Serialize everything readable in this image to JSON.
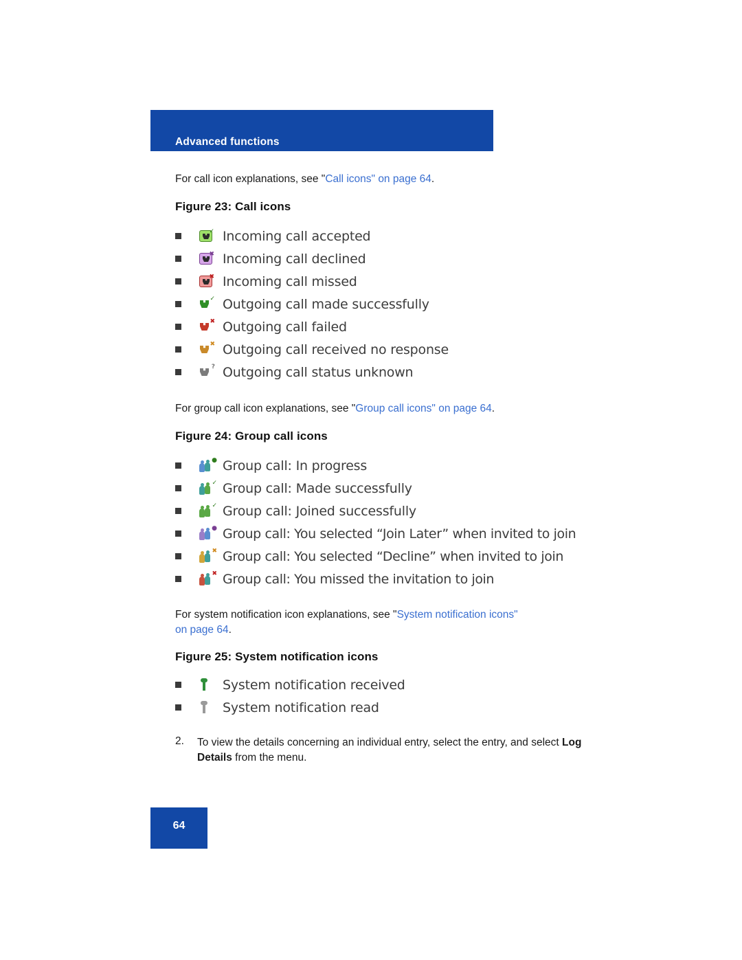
{
  "header": {
    "title": "Advanced functions"
  },
  "intro_call": {
    "prefix": "For call icon explanations, see \"",
    "link": "Call icons\" on page 64",
    "suffix": "."
  },
  "figure23": {
    "title": "Figure 23: Call icons",
    "items": [
      {
        "label": "Incoming call accepted",
        "icon": "incoming-call-accepted-icon"
      },
      {
        "label": "Incoming call declined",
        "icon": "incoming-call-declined-icon"
      },
      {
        "label": "Incoming call missed",
        "icon": "incoming-call-missed-icon"
      },
      {
        "label": "Outgoing call made successfully",
        "icon": "outgoing-call-success-icon"
      },
      {
        "label": "Outgoing call failed",
        "icon": "outgoing-call-failed-icon"
      },
      {
        "label": "Outgoing call received no response",
        "icon": "outgoing-call-no-response-icon"
      },
      {
        "label": "Outgoing call status unknown",
        "icon": "outgoing-call-unknown-icon"
      }
    ]
  },
  "intro_group": {
    "prefix": "For group call icon explanations, see \"",
    "link": "Group call icons\" on page 64",
    "suffix": "."
  },
  "figure24": {
    "title": "Figure 24: Group call icons",
    "items": [
      {
        "label": "Group call: In progress",
        "icon": "group-call-in-progress-icon"
      },
      {
        "label": "Group call: Made successfully",
        "icon": "group-call-made-icon"
      },
      {
        "label": "Group call: Joined successfully",
        "icon": "group-call-joined-icon"
      },
      {
        "label": "Group call: You selected “Join Later” when invited to join",
        "icon": "group-call-join-later-icon"
      },
      {
        "label": "Group call: You selected “Decline” when invited to join",
        "icon": "group-call-declined-icon"
      },
      {
        "label": "Group call: You missed the invitation to join",
        "icon": "group-call-missed-icon"
      }
    ]
  },
  "intro_system": {
    "prefix": "For system notification icon explanations, see \"",
    "link1": "System notification icons\"",
    "link2": "on page 64",
    "suffix": "."
  },
  "figure25": {
    "title": "Figure 25: System notification icons",
    "items": [
      {
        "label": "System notification received",
        "icon": "system-notification-received-icon"
      },
      {
        "label": "System notification read",
        "icon": "system-notification-read-icon"
      }
    ]
  },
  "step": {
    "number": "2.",
    "text_part1": "To view the details concerning an individual entry, select the entry, and select ",
    "bold": "Log Details",
    "text_part2": " from the menu."
  },
  "footer": {
    "page_number": "64"
  },
  "colors": {
    "brand_blue": "#1248a6",
    "link_blue": "#3a6fd0"
  }
}
